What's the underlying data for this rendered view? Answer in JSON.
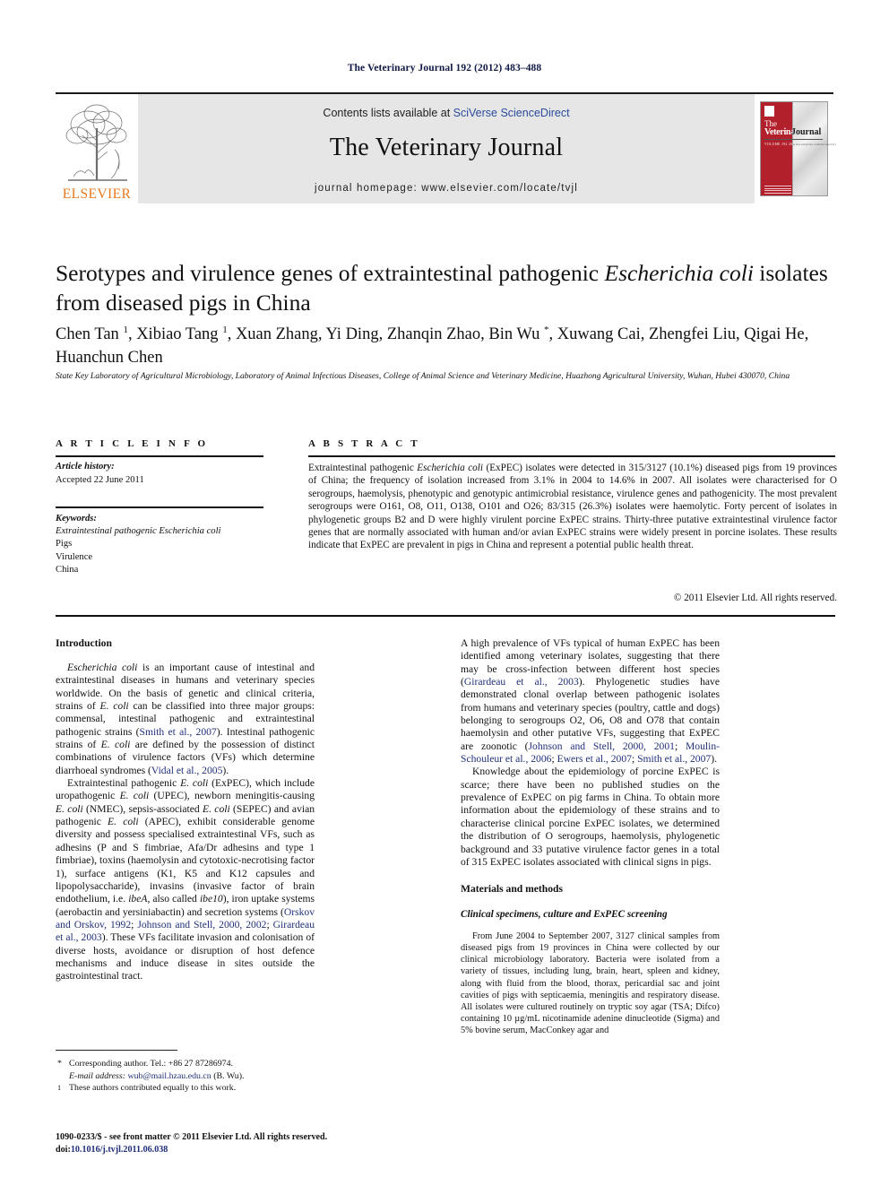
{
  "running_head": "The Veterinary Journal 192 (2012) 483–488",
  "masthead": {
    "contents_prefix": "Contents lists available at ",
    "contents_link": "SciVerse ScienceDirect",
    "journal_title": "The Veterinary Journal",
    "homepage": "journal homepage: www.elsevier.com/locate/tvjl",
    "publisher_wordmark": "ELSEVIER",
    "cover": {
      "line1": "The",
      "line2": "Veterinary",
      "line3": "Journal",
      "sub_left": "VOLUME 192  2012",
      "sub_right": "www.elsevier.com/locate/tvjl"
    }
  },
  "article": {
    "title_part1": "Serotypes and virulence genes of extraintestinal pathogenic ",
    "title_italic": "Escherichia coli",
    "title_part2": " isolates from diseased pigs in China",
    "authors": "Chen Tan 1, Xibiao Tang 1, Xuan Zhang, Yi Ding, Zhanqin Zhao, Bin Wu *, Xuwang Cai, Zhengfei Liu, Qigai He, Huanchun Chen",
    "affiliation": "State Key Laboratory of Agricultural Microbiology, Laboratory of Animal Infectious Diseases, College of Animal Science and Veterinary Medicine, Huazhong Agricultural University, Wuhan, Hubei 430070, China"
  },
  "info": {
    "heading": "A R T I C L E   I N F O",
    "history_label": "Article history:",
    "history_value": "Accepted 22 June 2011",
    "keywords_label": "Keywords:",
    "keywords": [
      "Extraintestinal pathogenic Escherichia coli",
      "Pigs",
      "Virulence",
      "China"
    ]
  },
  "abstract": {
    "heading": "A B S T R A C T",
    "text": "Extraintestinal pathogenic Escherichia coli (ExPEC) isolates were detected in 315/3127 (10.1%) diseased pigs from 19 provinces of China; the frequency of isolation increased from 3.1% in 2004 to 14.6% in 2007. All isolates were characterised for O serogroups, haemolysis, phenotypic and genotypic antimicrobial resistance, virulence genes and pathogenicity. The most prevalent serogroups were O161, O8, O11, O138, O101 and O26; 83/315 (26.3%) isolates were haemolytic. Forty percent of isolates in phylogenetic groups B2 and D were highly virulent porcine ExPEC strains. Thirty-three putative extraintestinal virulence factor genes that are normally associated with human and/or avian ExPEC strains were widely present in porcine isolates. These results indicate that ExPEC are prevalent in pigs in China and represent a potential public health threat.",
    "copyright": "© 2011 Elsevier Ltd. All rights reserved."
  },
  "body": {
    "intro_heading": "Introduction",
    "intro_p1": "Escherichia coli is an important cause of intestinal and extraintestinal diseases in humans and veterinary species worldwide. On the basis of genetic and clinical criteria, strains of E. coli can be classified into three major groups: commensal, intestinal pathogenic and extraintestinal pathogenic strains (Smith et al., 2007). Intestinal pathogenic strains of E. coli are defined by the possession of distinct combinations of virulence factors (VFs) which determine diarrhoeal syndromes (Vidal et al., 2005).",
    "intro_p2": "Extraintestinal pathogenic E. coli (ExPEC), which include uropathogenic E. coli (UPEC), newborn meningitis-causing E. coli (NMEC), sepsis-associated E. coli (SEPEC) and avian pathogenic E. coli (APEC), exhibit considerable genome diversity and possess specialised extraintestinal VFs, such as adhesins (P and S fimbriae, Afa/Dr adhesins and type 1 fimbriae), toxins (haemolysin and cytotoxic-necrotising factor 1), surface antigens (K1, K5 and K12 capsules and lipopolysaccharide), invasins (invasive factor of brain endothelium, i.e. ibeA, also called ibe10), iron uptake systems (aerobactin and yersiniabactin) and secretion systems (Orskov and Orskov, 1992; Johnson and Stell, 2000, 2002; Girardeau et al., 2003). These VFs facilitate invasion and colonisation of diverse hosts, avoidance or disruption of host defence mechanisms and induce disease in sites outside the gastrointestinal tract.",
    "right_p1": "A high prevalence of VFs typical of human ExPEC has been identified among veterinary isolates, suggesting that there may be cross-infection between different host species (Girardeau et al., 2003). Phylogenetic studies have demonstrated clonal overlap between pathogenic isolates from humans and veterinary species (poultry, cattle and dogs) belonging to serogroups O2, O6, O8 and O78 that contain haemolysin and other putative VFs, suggesting that ExPEC are zoonotic (Johnson and Stell, 2000, 2001; Moulin-Schouleur et al., 2006; Ewers et al., 2007; Smith et al., 2007).",
    "right_p2": "Knowledge about the epidemiology of porcine ExPEC is scarce; there have been no published studies on the prevalence of ExPEC on pig farms in China. To obtain more information about the epidemiology of these strains and to characterise clinical porcine ExPEC isolates, we determined the distribution of O serogroups, haemolysis, phylogenetic background and 33 putative virulence factor genes in a total of 315 ExPEC isolates associated with clinical signs in pigs.",
    "methods_heading": "Materials and methods",
    "methods_subheading": "Clinical specimens, culture and ExPEC screening",
    "methods_p1": "From June 2004 to September 2007, 3127 clinical samples from diseased pigs from 19 provinces in China were collected by our clinical microbiology laboratory. Bacteria were isolated from a variety of tissues, including lung, brain, heart, spleen and kidney, along with fluid from the blood, thorax, pericardial sac and joint cavities of pigs with septicaemia, meningitis and respiratory disease. All isolates were cultured routinely on tryptic soy agar (TSA; Difco) containing 10 µg/mL nicotinamide adenine dinucleotide (Sigma) and 5% bovine serum, MacConkey agar and"
  },
  "footnotes": {
    "corresponding": "Corresponding author. Tel.: +86 27 87286974.",
    "email_label": "E-mail address:",
    "email": "wub@mail.hzau.edu.cn",
    "email_suffix": "(B. Wu).",
    "equal_contrib": "These authors contributed equally to this work.",
    "issn_line": "1090-0233/$ - see front matter © 2011 Elsevier Ltd. All rights reserved.",
    "doi_label": "doi:",
    "doi": "10.1016/j.tvjl.2011.06.038"
  },
  "colors": {
    "link_blue": "#2a4b9b",
    "ref_blue": "#20307a",
    "elsevier_orange": "#e87a1e",
    "cover_red": "#b1202b",
    "masthead_gray": "#e6e6e6"
  }
}
